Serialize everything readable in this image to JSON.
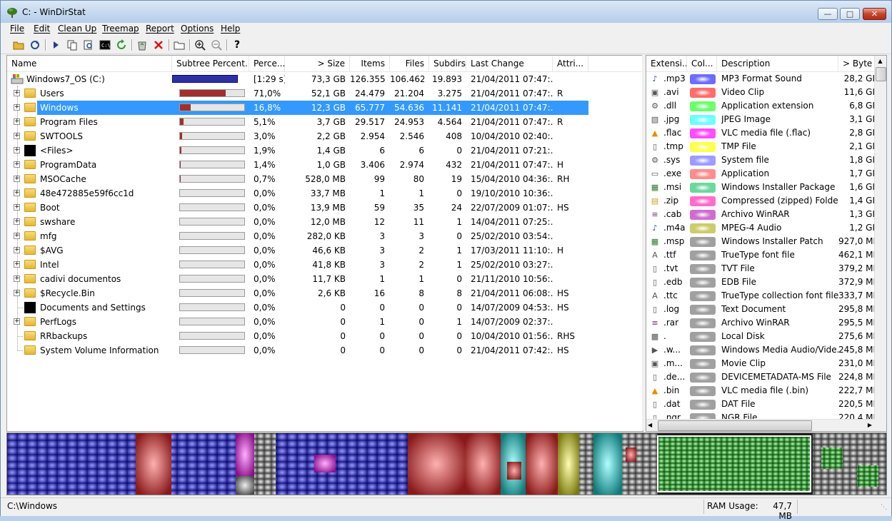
{
  "window": {
    "title": "C: - WinDirStat"
  },
  "menu": [
    "File",
    "Edit",
    "Clean Up",
    "Treemap",
    "Report",
    "Options",
    "Help"
  ],
  "toolbar": {
    "icons": [
      "open-folder-icon",
      "refresh-icon",
      "play-icon",
      "copy-icon",
      "find-icon",
      "command-prompt-icon",
      "refresh-green-icon",
      "recycle-icon",
      "delete-icon",
      "new-folder-icon",
      "zoom-in-icon",
      "zoom-out-icon",
      "help-icon"
    ]
  },
  "tree": {
    "columns": [
      "Name",
      "Subtree Percent...",
      "Perce...",
      "> Size",
      "Items",
      "Files",
      "Subdirs",
      "Last Change",
      "Attri..."
    ],
    "rows": [
      {
        "name": "Windows7_OS (C:)",
        "pct": "[1:29 s]",
        "size": "73,3 GB",
        "items": "126.355",
        "files": "106.462",
        "subdirs": "19.893",
        "change": "21/04/2011  07:47:...",
        "attr": "",
        "bar": 1.0,
        "icon": "drive",
        "expand": false,
        "root": true
      },
      {
        "name": "Users",
        "pct": "71,0%",
        "size": "52,1 GB",
        "items": "24.479",
        "files": "21.204",
        "subdirs": "3.275",
        "change": "21/04/2011  07:47:...",
        "attr": "R",
        "bar": 0.71,
        "icon": "folder",
        "expand": true
      },
      {
        "name": "Windows",
        "pct": "16,8%",
        "size": "12,3 GB",
        "items": "65.777",
        "files": "54.636",
        "subdirs": "11.141",
        "change": "21/04/2011  07:47:...",
        "attr": "",
        "bar": 0.168,
        "icon": "folder",
        "expand": true,
        "selected": true
      },
      {
        "name": "Program Files",
        "pct": "5,1%",
        "size": "3,7 GB",
        "items": "29.517",
        "files": "24.953",
        "subdirs": "4.564",
        "change": "21/04/2011  07:47:...",
        "attr": "R",
        "bar": 0.051,
        "icon": "folder",
        "expand": true
      },
      {
        "name": "SWTOOLS",
        "pct": "3,0%",
        "size": "2,2 GB",
        "items": "2.954",
        "files": "2.546",
        "subdirs": "408",
        "change": "10/04/2010  02:40:...",
        "attr": "",
        "bar": 0.03,
        "icon": "folder",
        "expand": true
      },
      {
        "name": "<Files>",
        "pct": "1,9%",
        "size": "1,4 GB",
        "items": "6",
        "files": "6",
        "subdirs": "0",
        "change": "21/04/2011  07:21:...",
        "attr": "",
        "bar": 0.019,
        "icon": "black",
        "expand": true
      },
      {
        "name": "ProgramData",
        "pct": "1,4%",
        "size": "1,0 GB",
        "items": "3.406",
        "files": "2.974",
        "subdirs": "432",
        "change": "21/04/2011  07:47:...",
        "attr": "H",
        "bar": 0.014,
        "icon": "folder",
        "expand": true
      },
      {
        "name": "MSOCache",
        "pct": "0,7%",
        "size": "528,0 MB",
        "items": "99",
        "files": "80",
        "subdirs": "19",
        "change": "15/04/2010  04:36:...",
        "attr": "RH",
        "bar": 0.007,
        "icon": "folder",
        "expand": true
      },
      {
        "name": "48e472885e59f6cc1d",
        "pct": "0,0%",
        "size": "33,7 MB",
        "items": "1",
        "files": "1",
        "subdirs": "0",
        "change": "19/10/2010  10:36:...",
        "attr": "",
        "bar": 0.0,
        "icon": "folder",
        "expand": true
      },
      {
        "name": "Boot",
        "pct": "0,0%",
        "size": "13,9 MB",
        "items": "59",
        "files": "35",
        "subdirs": "24",
        "change": "22/07/2009  01:07:...",
        "attr": "HS",
        "bar": 0.0,
        "icon": "folder",
        "expand": true
      },
      {
        "name": "swshare",
        "pct": "0,0%",
        "size": "12,0 MB",
        "items": "12",
        "files": "11",
        "subdirs": "1",
        "change": "14/04/2011  07:25:...",
        "attr": "",
        "bar": 0.0,
        "icon": "folder",
        "expand": true
      },
      {
        "name": "mfg",
        "pct": "0,0%",
        "size": "282,0 KB",
        "items": "3",
        "files": "3",
        "subdirs": "0",
        "change": "25/02/2010  03:54:...",
        "attr": "",
        "bar": 0.0,
        "icon": "folder",
        "expand": true
      },
      {
        "name": "$AVG",
        "pct": "0,0%",
        "size": "46,6 KB",
        "items": "3",
        "files": "2",
        "subdirs": "1",
        "change": "17/03/2011  11:10:...",
        "attr": "H",
        "bar": 0.0,
        "icon": "folder",
        "expand": true
      },
      {
        "name": "Intel",
        "pct": "0,0%",
        "size": "41,8 KB",
        "items": "3",
        "files": "2",
        "subdirs": "1",
        "change": "25/02/2010  03:27:...",
        "attr": "",
        "bar": 0.0,
        "icon": "folder",
        "expand": true
      },
      {
        "name": "cadivi documentos",
        "pct": "0,0%",
        "size": "11,7 KB",
        "items": "1",
        "files": "1",
        "subdirs": "0",
        "change": "21/11/2010  10:56:...",
        "attr": "",
        "bar": 0.0,
        "icon": "folder",
        "expand": true
      },
      {
        "name": "$Recycle.Bin",
        "pct": "0,0%",
        "size": "2,6 KB",
        "items": "16",
        "files": "8",
        "subdirs": "8",
        "change": "21/04/2011  06:08:...",
        "attr": "HS",
        "bar": 0.0,
        "icon": "folder",
        "expand": true
      },
      {
        "name": "Documents and Settings",
        "pct": "0,0%",
        "size": "0",
        "items": "0",
        "files": "0",
        "subdirs": "0",
        "change": "14/07/2009  04:53:...",
        "attr": "HS",
        "bar": 0.0,
        "icon": "black",
        "expand": false
      },
      {
        "name": "PerfLogs",
        "pct": "0,0%",
        "size": "0",
        "items": "1",
        "files": "0",
        "subdirs": "1",
        "change": "14/07/2009  02:37:...",
        "attr": "",
        "bar": 0.0,
        "icon": "folder",
        "expand": true
      },
      {
        "name": "RRbackups",
        "pct": "0,0%",
        "size": "0",
        "items": "0",
        "files": "0",
        "subdirs": "0",
        "change": "10/04/2010  01:56:...",
        "attr": "RHS",
        "bar": 0.0,
        "icon": "folder",
        "expand": false
      },
      {
        "name": "System Volume Information",
        "pct": "0,0%",
        "size": "0",
        "items": "0",
        "files": "0",
        "subdirs": "0",
        "change": "21/04/2011  07:42:...",
        "attr": "HS",
        "bar": 0.0,
        "icon": "folder",
        "expand": false
      }
    ]
  },
  "extensions": {
    "columns": [
      "Extensi...",
      "Col...",
      "Description",
      "> Byte"
    ],
    "rows": [
      {
        "ext": ".mp3",
        "color": "#6c6cff",
        "desc": "MP3 Format Sound",
        "bytes": "28,2 GI",
        "icon": "music-icon"
      },
      {
        "ext": ".avi",
        "color": "#ff6c6c",
        "desc": "Video Clip",
        "bytes": "11,6 GI",
        "icon": "video-icon"
      },
      {
        "ext": ".dll",
        "color": "#6cff6c",
        "desc": "Application extension",
        "bytes": "6,8 GI",
        "icon": "dll-icon"
      },
      {
        "ext": ".jpg",
        "color": "#6cffff",
        "desc": "JPEG Image",
        "bytes": "3,1 GI",
        "icon": "image-icon"
      },
      {
        "ext": ".flac",
        "color": "#ff4cff",
        "desc": "VLC media file (.flac)",
        "bytes": "2,8 GI",
        "icon": "vlc-icon"
      },
      {
        "ext": ".tmp",
        "color": "#ffff4c",
        "desc": "TMP File",
        "bytes": "2,1 GI",
        "icon": "file-icon"
      },
      {
        "ext": ".sys",
        "color": "#9c9cff",
        "desc": "System file",
        "bytes": "1,8 GI",
        "icon": "system-file-icon"
      },
      {
        "ext": ".exe",
        "color": "#ff8c8c",
        "desc": "Application",
        "bytes": "1,7 GI",
        "icon": "exe-icon"
      },
      {
        "ext": ".msi",
        "color": "#6cd89c",
        "desc": "Windows Installer Package",
        "bytes": "1,6 GI",
        "icon": "installer-icon"
      },
      {
        "ext": ".zip",
        "color": "#ff6ccc",
        "desc": "Compressed (zipped) Folder",
        "bytes": "1,4 GI",
        "icon": "zip-icon"
      },
      {
        "ext": ".cab",
        "color": "#d06cd0",
        "desc": "Archivo WinRAR",
        "bytes": "1,3 GI",
        "icon": "winrar-icon"
      },
      {
        "ext": ".m4a",
        "color": "#cccc6c",
        "desc": "MPEG-4 Audio",
        "bytes": "1,2 GI",
        "icon": "music-icon"
      },
      {
        "ext": ".msp",
        "color": "#a0a0a0",
        "desc": "Windows Installer Patch",
        "bytes": "927,0 MI",
        "icon": "installer-icon"
      },
      {
        "ext": ".ttf",
        "color": "#a0a0a0",
        "desc": "TrueType font file",
        "bytes": "462,1 MI",
        "icon": "font-icon"
      },
      {
        "ext": ".tvt",
        "color": "#a0a0a0",
        "desc": "TVT File",
        "bytes": "379,2 MI",
        "icon": "file-icon"
      },
      {
        "ext": ".edb",
        "color": "#a0a0a0",
        "desc": "EDB File",
        "bytes": "372,9 MI",
        "icon": "file-icon"
      },
      {
        "ext": ".ttc",
        "color": "#a0a0a0",
        "desc": "TrueType collection font file",
        "bytes": "333,7 MI",
        "icon": "font-icon"
      },
      {
        "ext": ".log",
        "color": "#a0a0a0",
        "desc": "Text Document",
        "bytes": "295,8 MI",
        "icon": "file-icon"
      },
      {
        "ext": ".rar",
        "color": "#a0a0a0",
        "desc": "Archivo WinRAR",
        "bytes": "295,5 MI",
        "icon": "winrar-icon"
      },
      {
        "ext": ".",
        "color": "#a0a0a0",
        "desc": "Local Disk",
        "bytes": "275,6 MI",
        "icon": "drive-icon"
      },
      {
        "ext": ".w...",
        "color": "#a0a0a0",
        "desc": "Windows Media Audio/Vide...",
        "bytes": "245,8 MI",
        "icon": "media-icon"
      },
      {
        "ext": ".m...",
        "color": "#a0a0a0",
        "desc": "Movie Clip",
        "bytes": "231,0 MI",
        "icon": "video-icon"
      },
      {
        "ext": ".de...",
        "color": "#a0a0a0",
        "desc": "DEVICEMETADATA-MS File",
        "bytes": "224,8 MI",
        "icon": "file-icon"
      },
      {
        "ext": ".bin",
        "color": "#a0a0a0",
        "desc": "VLC media file (.bin)",
        "bytes": "222,7 MI",
        "icon": "vlc-icon"
      },
      {
        "ext": ".dat",
        "color": "#a0a0a0",
        "desc": "DAT File",
        "bytes": "220,5 MI",
        "icon": "file-icon"
      },
      {
        "ext": ".ngr",
        "color": "#a0a0a0",
        "desc": "NGR File",
        "bytes": "220,4 MI",
        "icon": "file-icon"
      }
    ]
  },
  "status": {
    "path": "C:\\Windows",
    "ram_label": "RAM Usage:",
    "ram_value": "47,7 MB"
  }
}
